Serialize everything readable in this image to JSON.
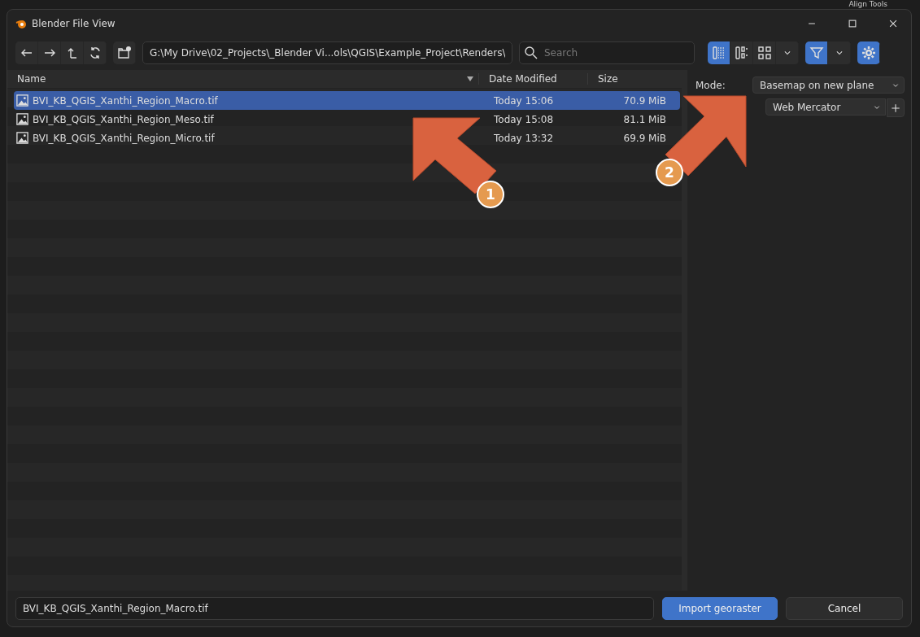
{
  "background_panel": {
    "label": "Align Tools"
  },
  "window": {
    "title": "Blender File View"
  },
  "toolbar": {
    "path": "G:\\My Drive\\02_Projects\\_Blender Vi...ols\\QGIS\\Example_Project\\Renders\\",
    "search": {
      "placeholder": "Search"
    },
    "view_modes": [
      {
        "kind": "vertical-list",
        "selected": true
      },
      {
        "kind": "horizontal-list",
        "selected": false
      },
      {
        "kind": "thumbnails",
        "selected": false
      }
    ],
    "filter": {
      "on": true
    },
    "settings": {
      "on": true
    }
  },
  "table": {
    "columns": [
      "Name",
      "Date Modified",
      "Size"
    ],
    "rows": [
      {
        "name": "BVI_KB_QGIS_Xanthi_Region_Macro.tif",
        "date": "Today 15:06",
        "size": "70.9 MiB",
        "selected": true
      },
      {
        "name": "BVI_KB_QGIS_Xanthi_Region_Meso.tif",
        "date": "Today 15:08",
        "size": "81.1 MiB",
        "selected": false
      },
      {
        "name": "BVI_KB_QGIS_Xanthi_Region_Micro.tif",
        "date": "Today 13:32",
        "size": "69.9 MiB",
        "selected": false
      }
    ]
  },
  "options": {
    "mode_label": "Mode:",
    "mode": "Basemap on new plane",
    "projection": "Web Mercator"
  },
  "footer": {
    "filename": "BVI_KB_QGIS_Xanthi_Region_Macro.tif",
    "buttons": [
      {
        "label": "Import georaster",
        "kind": "primary"
      },
      {
        "label": "Cancel",
        "kind": "secondary"
      }
    ]
  },
  "annotations": [
    {
      "number": "1"
    },
    {
      "number": "2"
    }
  ]
}
